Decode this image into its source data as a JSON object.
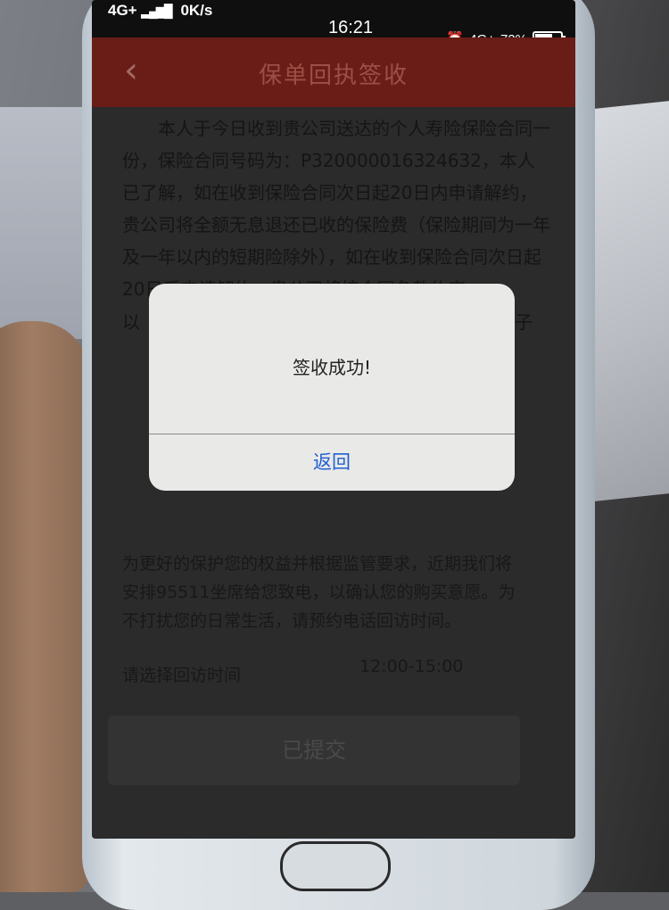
{
  "status_bar": {
    "network": "4G+",
    "speed": "0K/s",
    "time": "16:21",
    "right_network": "4G+",
    "battery_percent_text": "72%",
    "battery_level": 0.72
  },
  "navbar": {
    "title": "保单回执签收"
  },
  "terms": {
    "text": "本人于今日收到贵公司送达的个人寿险保险合同一份，保险合同号码为：P320000016324632，本人已了解，如在收到保险合同次日起20日内申请解约，贵公司将全额无息退还已收的保险费（保险期间为一年及一年以内的短期险除外），如在收到保险合同次日起20日后申请解约，贵公司将按合同条款约定",
    "tail_left": "以",
    "tail_right": "子"
  },
  "notice": {
    "text": "为更好的保护您的权益并根据监管要求，近期我们将安排95511坐席给您致电，以确认您的购买意愿。为不打扰您的日常生活，请预约电话回访时间。"
  },
  "revisit": {
    "label": "请选择回访时间",
    "value": "12:00-15:00"
  },
  "submit": {
    "label": "已提交"
  },
  "dialog": {
    "message": "签收成功!",
    "button": "返回"
  }
}
